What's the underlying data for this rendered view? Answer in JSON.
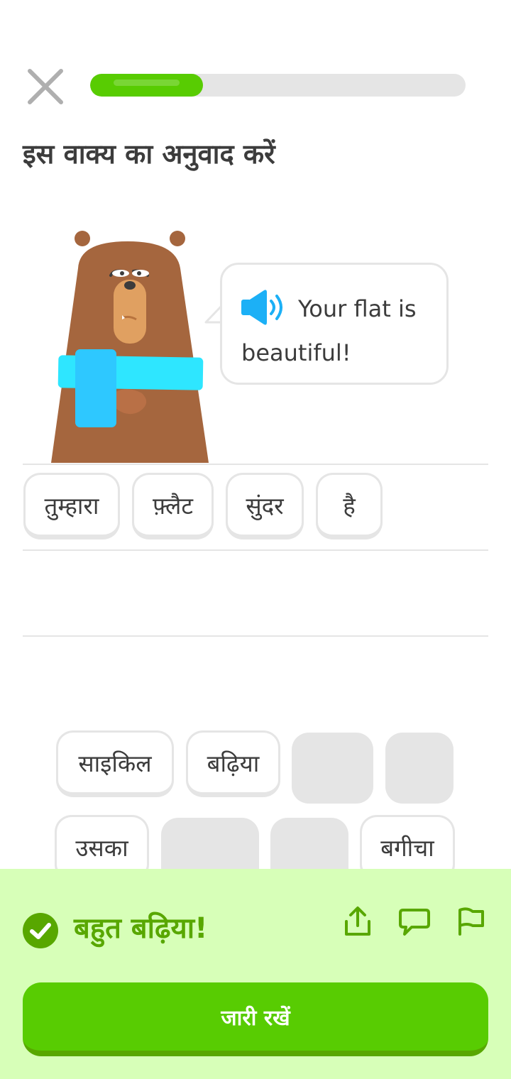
{
  "header": {
    "close_icon": "close-x-icon",
    "progress_fraction": 0.3
  },
  "title": "इस वाक्य का अनुवाद करें",
  "prompt": {
    "speaker_icon": "speaker-icon",
    "sentence": "Your flat is beautiful!"
  },
  "answer_tiles": [
    "तुम्हारा",
    "फ़्लैट",
    "सुंदर",
    "है"
  ],
  "word_bank": {
    "row1": [
      "साइकिल",
      "बढ़िया"
    ],
    "row2_first": "उसका",
    "row2_last": "बगीचा"
  },
  "feedback": {
    "title": "बहुत बढ़िया!",
    "icons": [
      "share-icon",
      "comment-icon",
      "report-flag-icon"
    ],
    "continue_label": "जारी रखें"
  },
  "colors": {
    "accent_green": "#58cc02",
    "feedback_bg": "#d7ffb8",
    "feedback_text": "#58a700",
    "speaker_blue": "#1cb0f6"
  }
}
